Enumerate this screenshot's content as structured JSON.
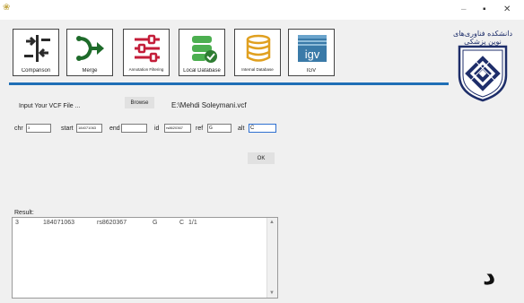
{
  "window": {
    "minimize_glyph": "–",
    "maximize_glyph": "▪",
    "close_glyph": "✕",
    "app_icon": "app-icon"
  },
  "toolbar": {
    "tools": [
      {
        "label": "Comparison",
        "icon": "compare-arrows-icon",
        "color": "#2a2a2a"
      },
      {
        "label": "Merge",
        "icon": "merge-icon",
        "color": "#1e6b2a"
      },
      {
        "label": "Annotation Filtering",
        "icon": "sliders-icon",
        "color": "#c41e3a"
      },
      {
        "label": "Local Database",
        "icon": "database-check-icon",
        "color": "#4caf50"
      },
      {
        "label": "Internal Database",
        "icon": "database-icon",
        "color": "#e0a020"
      },
      {
        "label": "IGV",
        "icon": "igv-icon",
        "color": "#3a7aa8",
        "logo_text": "igv"
      }
    ],
    "accent_color": "#1f6fb6"
  },
  "university": {
    "name": "دانشکده فناوری‌های نوین پزشکی",
    "emblem": "university-emblem"
  },
  "file_row": {
    "label": "Input Your VCF File ...",
    "browse_label": "Browse",
    "path": "E:\\Mehdi Soleymani.vcf"
  },
  "params": {
    "chr_label": "chr",
    "chr_value": "3",
    "start_label": "start",
    "start_value": "184071063",
    "end_label": "end",
    "end_value": "",
    "id_label": "id",
    "id_value": "rs8620367",
    "ref_label": "ref",
    "ref_value": "G",
    "alt_label": "alt",
    "alt_value": "C"
  },
  "ok_label": "OK",
  "result": {
    "label": "Result:",
    "row": [
      "3",
      "184071063",
      "rs8620367",
      "G",
      "C",
      "1/1"
    ]
  },
  "overlay_letter": "د"
}
